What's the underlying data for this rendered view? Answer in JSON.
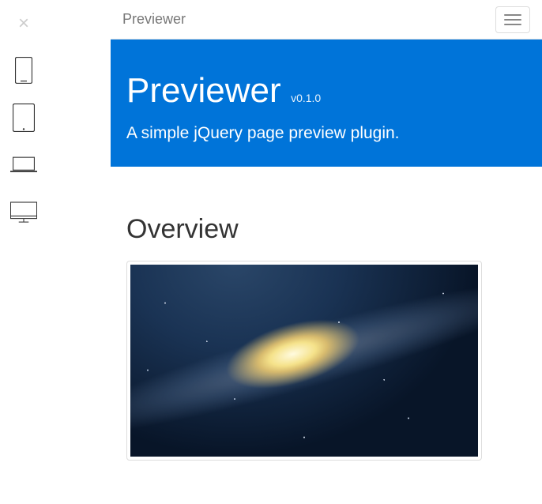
{
  "sidebar": {
    "close_symbol": "×",
    "devices": [
      {
        "name": "phone",
        "label": "Phone preview"
      },
      {
        "name": "tablet",
        "label": "Tablet preview"
      },
      {
        "name": "laptop",
        "label": "Laptop preview"
      },
      {
        "name": "desktop",
        "label": "Desktop preview"
      }
    ]
  },
  "navbar": {
    "brand": "Previewer",
    "menu_label": "Toggle navigation"
  },
  "hero": {
    "title": "Previewer",
    "version": "v0.1.0",
    "subtitle": "A simple jQuery page preview plugin."
  },
  "section": {
    "title": "Overview"
  },
  "colors": {
    "accent": "#0074d9"
  }
}
